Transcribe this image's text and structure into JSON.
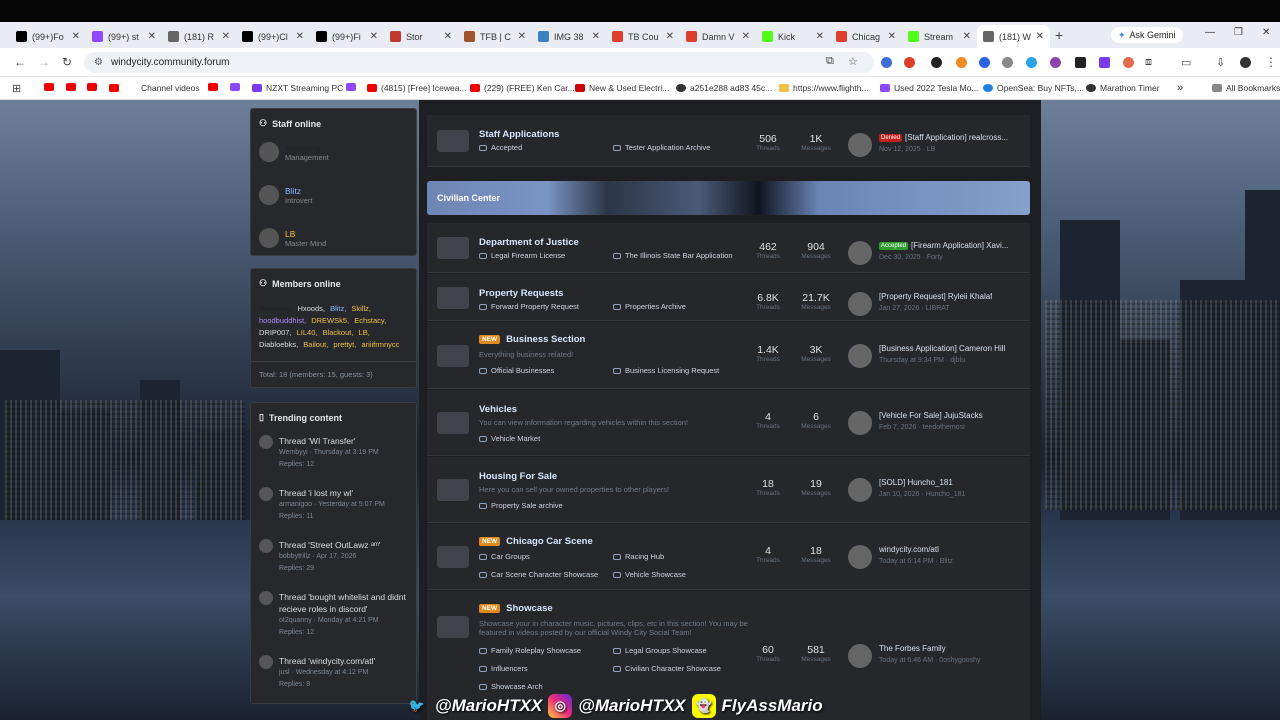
{
  "browser": {
    "tabs": [
      {
        "label": "(99+)Fo",
        "color": "#000"
      },
      {
        "label": "(99+) st",
        "color": "#9146ff"
      },
      {
        "label": "(181) R",
        "color": "#666"
      },
      {
        "label": "(99+)Cl",
        "color": "#000"
      },
      {
        "label": "(99+)Fi",
        "color": "#000"
      },
      {
        "label": "Stor",
        "color": "#c0392b"
      },
      {
        "label": "TFB | C",
        "color": "#a0522d"
      },
      {
        "label": "IMG 38",
        "color": "#3b82c4"
      },
      {
        "label": "TB Cou",
        "color": "#e03e2d"
      },
      {
        "label": "Damn V",
        "color": "#e03e2d"
      },
      {
        "label": "Kick",
        "color": "#53fc18"
      },
      {
        "label": "Chicag",
        "color": "#e03e2d"
      },
      {
        "label": "Stream",
        "color": "#53fc18"
      },
      {
        "label": "(181) W",
        "color": "#666"
      }
    ],
    "ask_gemini": "Ask Gemini",
    "url": "windycity.community.forum",
    "bookmarks": [
      "Channel videos",
      "NZXT Streaming PC",
      "(4815) [Free] Icewea...",
      "(229) (FREE) Ken Car...",
      "New & Used Electri...",
      "a251e288 ad83 45c...",
      "https://www.flighth...",
      "Used 2022 Tesla Mo...",
      "OpenSea: Buy NFTs,...",
      "Marathon Timer",
      "All Bookmarks"
    ]
  },
  "sidebar": {
    "staff_title": "Staff online",
    "staff": [
      {
        "name": "Annoying",
        "role": "Management",
        "color": "#222"
      },
      {
        "name": "Blitz",
        "role": "Introvert",
        "color": "#8ab8ff"
      },
      {
        "name": "LB",
        "role": "Master Mind",
        "color": "#f0c040"
      }
    ],
    "members_title": "Members online",
    "members": [
      {
        "n": "Annoying,",
        "c": "#222"
      },
      {
        "n": "Hxoods,",
        "c": "#ddd"
      },
      {
        "n": "Blitz,",
        "c": "#8ab8ff"
      },
      {
        "n": "Skillz,",
        "c": "#f0c040"
      },
      {
        "n": "hoodbuddhist,",
        "c": "#b08cff"
      },
      {
        "n": "DREWSk5,",
        "c": "#f0c040"
      },
      {
        "n": "Echstacy,",
        "c": "#f0c040"
      },
      {
        "n": "DRIP007,",
        "c": "#ddd"
      },
      {
        "n": "LIL40,",
        "c": "#f0c040"
      },
      {
        "n": "Blackout,",
        "c": "#f0c040"
      },
      {
        "n": "LB,",
        "c": "#f0c040"
      },
      {
        "n": "Diabloebks,",
        "c": "#ddd"
      },
      {
        "n": "Bailout,",
        "c": "#f0c040"
      },
      {
        "n": "prettyt,",
        "c": "#f0c040"
      },
      {
        "n": "ariiifrmnycc",
        "c": "#f0c040"
      }
    ],
    "members_total": "Total: 18 (members: 15, guests: 3)",
    "trending_title": "Trending content",
    "trending": [
      {
        "title": "Thread 'WI Transfer'",
        "meta": "Wembyyi · Thursday at 3:19 PM",
        "replies": "Replies: 12"
      },
      {
        "title": "Thread 'i lost my wl'",
        "meta": "armanigoo · Yesterday at 5:07 PM",
        "replies": "Replies: 11"
      },
      {
        "title": "Thread 'Street OutLawz ᵃᵐ'",
        "meta": "bobbytrillz · Apr 17, 2026",
        "replies": "Replies: 29"
      },
      {
        "title": "Thread 'bought whitelist and didnt recieve roles in discord'",
        "meta": "ot2quanny · Monday at 4:21 PM",
        "replies": "Replies: 12"
      },
      {
        "title": "Thread 'windycity.com/atl'",
        "meta": "jusl · Wednesday at 4:12 PM",
        "replies": "Replies: 8"
      }
    ]
  },
  "forum": {
    "category": "Civilian Center",
    "nodes": [
      {
        "title": "Staff Applications",
        "new": false,
        "desc": "",
        "subs": [
          "Accepted",
          "Tester Application Archive"
        ],
        "threads": "506",
        "messages": "1K",
        "last_prefix": "Denied",
        "last_prefix_color": "#c0201e",
        "last_title": "[Staff Application] realcross...",
        "last_meta": "Nov 12, 2025 · LB"
      },
      {
        "title": "Department of Justice",
        "new": false,
        "desc": "",
        "subs": [
          "Legal Firearm License",
          "The Illinois State Bar Application"
        ],
        "threads": "462",
        "messages": "904",
        "last_prefix": "Accepted",
        "last_prefix_color": "#2f9e2f",
        "last_title": "[Firearm Application] Xavi...",
        "last_meta": "Dec 30, 2025 · Forty"
      },
      {
        "title": "Property Requests",
        "new": false,
        "desc": "",
        "subs": [
          "Forward Property Request",
          "Properties Archive"
        ],
        "threads": "6.8K",
        "messages": "21.7K",
        "last_prefix": "",
        "last_prefix_color": "",
        "last_title": "[Property Request] Ryleii Khalaf",
        "last_meta": "Jan 27, 2026 · LIBRAT"
      },
      {
        "title": "Business Section",
        "new": true,
        "desc": "Everything business related!",
        "subs": [
          "Official Businesses",
          "Business Licensing Request"
        ],
        "threads": "1.4K",
        "messages": "3K",
        "last_prefix": "",
        "last_prefix_color": "",
        "last_title": "[Business Application] Cameron Hill",
        "last_meta": "Thursday at 9:34 PM · djblu"
      },
      {
        "title": "Vehicles",
        "new": false,
        "desc": "You can view information regarding vehicles within this section!",
        "subs": [
          "Vehicle Market"
        ],
        "threads": "4",
        "messages": "6",
        "last_prefix": "",
        "last_prefix_color": "",
        "last_title": "[Vehicle For Sale] JujuStacks",
        "last_meta": "Feb 7, 2026 · teedothemost"
      },
      {
        "title": "Housing For Sale",
        "new": false,
        "desc": "Here you can sell your owned properties to other players!",
        "subs": [
          "Property Sale archive"
        ],
        "threads": "18",
        "messages": "19",
        "last_prefix": "",
        "last_prefix_color": "",
        "last_title": "[SOLD] Huncho_181",
        "last_meta": "Jan 10, 2026 · Huncho_181"
      },
      {
        "title": "Chicago Car Scene",
        "new": true,
        "desc": "",
        "subs": [
          "Car Groups",
          "Racing Hub",
          "Car Scene Character Showcase",
          "Vehicle Showcase"
        ],
        "threads": "4",
        "messages": "18",
        "last_prefix": "",
        "last_prefix_color": "",
        "last_title": "windycity.com/atl",
        "last_meta": "Today at 6:14 PM · Blitz"
      },
      {
        "title": "Showcase",
        "new": true,
        "desc": "Showcase your in character music, pictures, clips, etc in this section! You may be featured in videos posted by our official Windy City Social Team!",
        "subs": [
          "Family Roleplay Showcase",
          "Legal Groups Showcase",
          "Influencers",
          "Civilian Character Showcase",
          "Showcase Arch"
        ],
        "threads": "60",
        "messages": "581",
        "last_prefix": "",
        "last_prefix_color": "",
        "last_title": "The Forbes Family",
        "last_meta": "Today at 6:46 AM · 0oshygooshy"
      }
    ],
    "threads_label": "Threads",
    "messages_label": "Messages"
  },
  "overlay": {
    "twitter": "@MarioHTXX",
    "instagram": "@MarioHTXX",
    "snapchat": "FlyAssMario"
  }
}
